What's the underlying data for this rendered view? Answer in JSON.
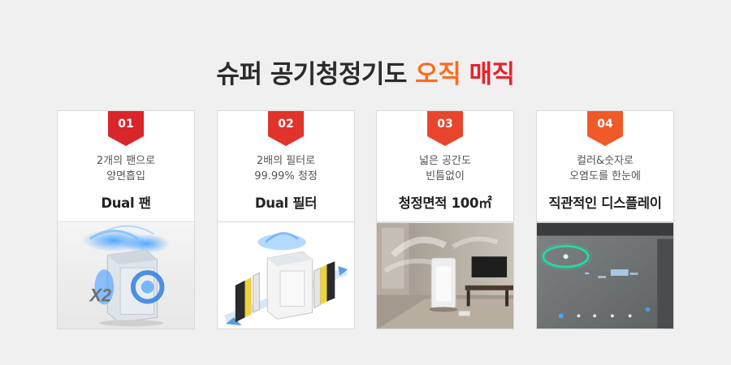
{
  "headline": {
    "part1": "슈퍼 공기청정기도 ",
    "part2": "오직",
    "part3": " ",
    "part4": "매직",
    "color_main": "#2b2b2b",
    "color_orange": "#ff6a1a",
    "color_red": "#e8232a"
  },
  "cards": [
    {
      "number": "01",
      "line1": "2개의 팬으로",
      "line2": "양면흡입",
      "feature": "Dual 팬",
      "badge_color": "#d9262a",
      "photo_text": "X2"
    },
    {
      "number": "02",
      "line1": "2배의 필터로",
      "line2": "99.99% 청정",
      "feature": "Dual 필터",
      "badge_color": "#e0332c"
    },
    {
      "number": "03",
      "line1": "넓은 공간도",
      "line2": "빈틈없이",
      "feature": "청정면적 100㎡",
      "badge_color": "#e8452c"
    },
    {
      "number": "04",
      "line1": "컬러&숫자로",
      "line2": "오염도를 한눈에",
      "feature": "직관적인 디스플레이",
      "badge_color": "#f05a28"
    }
  ]
}
